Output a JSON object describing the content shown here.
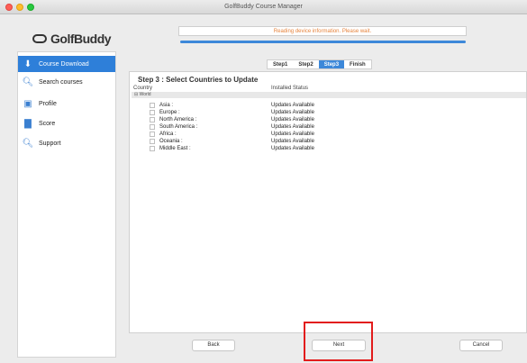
{
  "window": {
    "title": "GolfBuddy Course Manager"
  },
  "logo": {
    "text": "GolfBuddy"
  },
  "sidebar": {
    "items": [
      {
        "label": "Course Download",
        "icon": "download-icon",
        "active": true
      },
      {
        "label": "Search courses",
        "icon": "search-icon",
        "active": false
      },
      {
        "label": "Profile",
        "icon": "profile-icon",
        "active": false
      },
      {
        "label": "Score",
        "icon": "score-icon",
        "active": false
      },
      {
        "label": "Support",
        "icon": "support-icon",
        "active": false
      }
    ]
  },
  "status": {
    "message": "Reading device information. Please wait.",
    "progress_fraction": 1.0
  },
  "steps": [
    {
      "label": "Step1",
      "active": false
    },
    {
      "label": "Step2",
      "active": false
    },
    {
      "label": "Step3",
      "active": true
    },
    {
      "label": "Finish",
      "active": false
    }
  ],
  "panel": {
    "heading": "Step 3 : Select Countries to Update",
    "col_country": "Country",
    "col_status": "Installed Status",
    "root": "World",
    "rows": [
      {
        "name": "Asia          :",
        "status": "Updates Available"
      },
      {
        "name": "Europe        :",
        "status": "Updates Available"
      },
      {
        "name": "North America :",
        "status": "Updates Available"
      },
      {
        "name": "South America :",
        "status": "Updates Available"
      },
      {
        "name": "Africa        :",
        "status": "Updates Available"
      },
      {
        "name": "Oceania       :",
        "status": "Updates Available"
      },
      {
        "name": "Middle East   :",
        "status": "Updates Available"
      }
    ]
  },
  "buttons": {
    "back": "Back",
    "next": "Next",
    "cancel": "Cancel"
  },
  "colors": {
    "accent": "#3d88d9",
    "highlight": "#e21c1c",
    "status_text": "#e6833c"
  }
}
